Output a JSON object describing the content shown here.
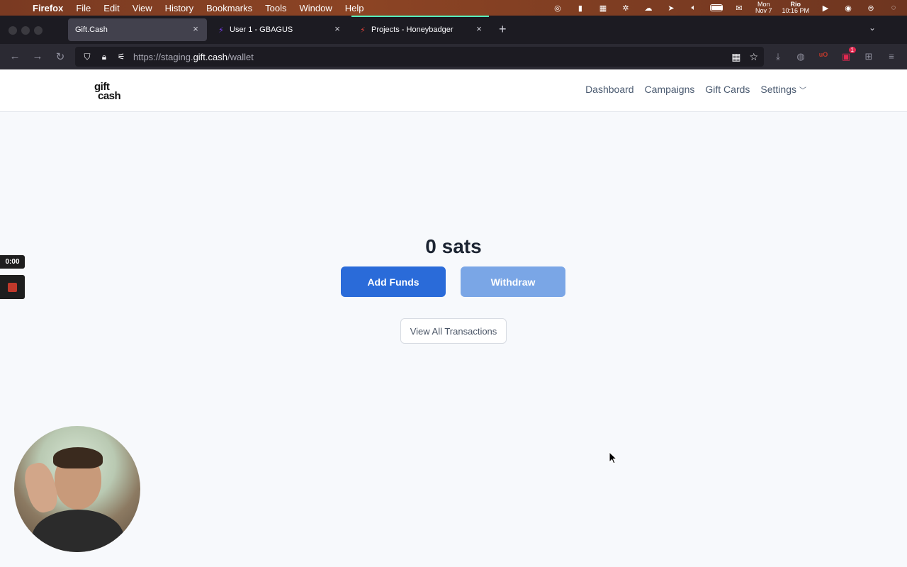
{
  "menubar": {
    "app_name": "Firefox",
    "items": [
      "File",
      "Edit",
      "View",
      "History",
      "Bookmarks",
      "Tools",
      "Window",
      "Help"
    ],
    "date_day": "Mon",
    "date_date": "Nov 7",
    "clock_label": "Rio",
    "clock_time": "10:16 PM"
  },
  "browser": {
    "tabs": [
      {
        "title": "Gift.Cash",
        "active": true
      },
      {
        "title": "User 1 - GBAGUS",
        "active": false
      },
      {
        "title": "Projects - Honeybadger",
        "active": false
      }
    ],
    "url_prefix": "https://staging.",
    "url_host": "gift.cash",
    "url_path": "/wallet",
    "extension_badge": "1"
  },
  "site": {
    "logo_line1": "gift",
    "logo_line2": "cash",
    "nav": {
      "dashboard": "Dashboard",
      "campaigns": "Campaigns",
      "gift_cards": "Gift Cards",
      "settings": "Settings"
    }
  },
  "wallet": {
    "balance": "0 sats",
    "add_funds_label": "Add Funds",
    "withdraw_label": "Withdraw",
    "view_transactions_label": "View All Transactions"
  },
  "recorder": {
    "timer": "0:00"
  },
  "colors": {
    "primary": "#2a6bd9",
    "primary_disabled": "#7aa6e6",
    "menubar": "#8c4424"
  }
}
